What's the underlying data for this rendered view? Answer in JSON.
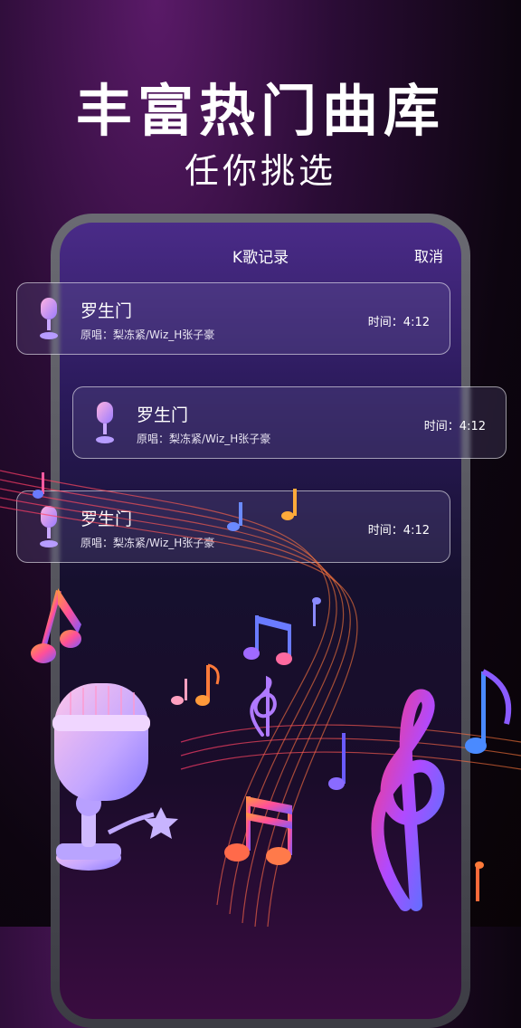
{
  "promo": {
    "headline": "丰富热门曲库",
    "subline": "任你挑选"
  },
  "screen": {
    "title": "K歌记录",
    "cancel": "取消"
  },
  "records": [
    {
      "song": "罗生门",
      "artist": "原唱：梨冻紧/Wiz_H张子豪",
      "time": "时间：4:12"
    },
    {
      "song": "罗生门",
      "artist": "原唱：梨冻紧/Wiz_H张子豪",
      "time": "时间：4:12"
    },
    {
      "song": "罗生门",
      "artist": "原唱：梨冻紧/Wiz_H张子豪",
      "time": "时间：4:12"
    }
  ],
  "icons": {
    "record_icon": "microphone-icon",
    "decorations": [
      "music-note-icon",
      "treble-clef-icon",
      "microphone-illustration",
      "star-icon"
    ]
  },
  "colors": {
    "accent_purple": "#6a2a8a",
    "note_pink": "#ff4f9a",
    "note_orange": "#ff8a3d",
    "note_blue": "#5a7bff"
  }
}
